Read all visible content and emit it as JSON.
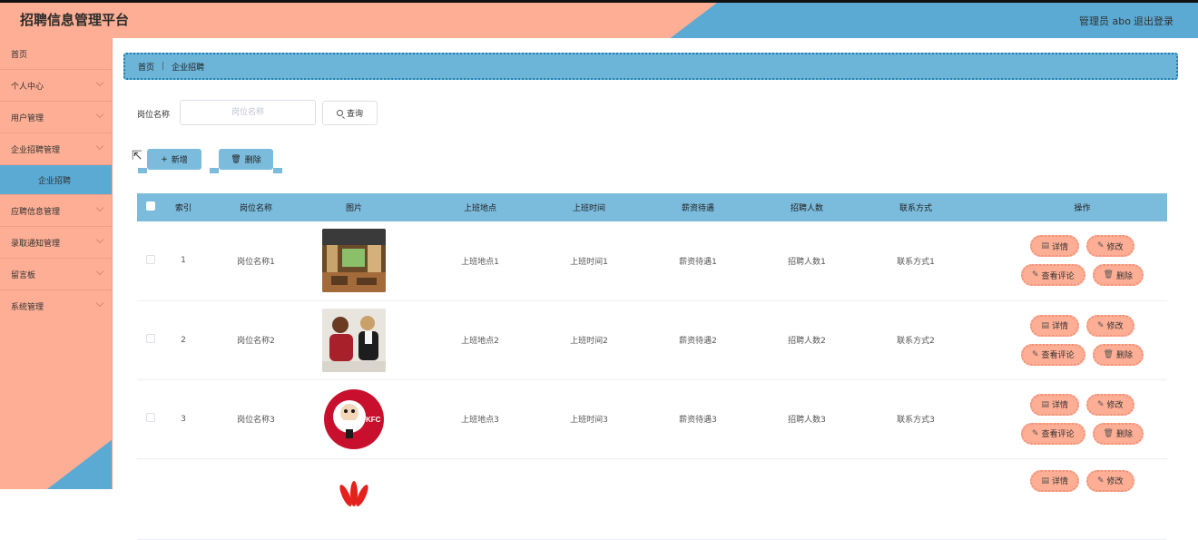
{
  "header": {
    "title": "招聘信息管理平台",
    "user": "管理员 abo",
    "logout": "退出登录"
  },
  "sidebar": {
    "items": [
      {
        "label": "首页"
      },
      {
        "label": "个人中心"
      },
      {
        "label": "用户管理"
      },
      {
        "label": "企业招聘管理"
      },
      {
        "label": "企业招聘"
      },
      {
        "label": "应聘信息管理"
      },
      {
        "label": "录取通知管理"
      },
      {
        "label": "留言板"
      },
      {
        "label": "系统管理"
      }
    ]
  },
  "breadcrumb": {
    "home": "首页",
    "sep": "|",
    "current": "企业招聘"
  },
  "search": {
    "label": "岗位名称",
    "placeholder": "岗位名称",
    "button": "查询"
  },
  "toolbar": {
    "add": "新增",
    "delete": "删除"
  },
  "table": {
    "headers": [
      "索引",
      "岗位名称",
      "图片",
      "上班地点",
      "上班时间",
      "薪资待遇",
      "招聘人数",
      "联系方式",
      "操作"
    ],
    "rows": [
      {
        "index": "1",
        "name": "岗位名称1",
        "place": "上班地点1",
        "time": "上班时间1",
        "salary": "薪资待遇1",
        "count": "招聘人数1",
        "contact": "联系方式1"
      },
      {
        "index": "2",
        "name": "岗位名称2",
        "place": "上班地点2",
        "time": "上班时间2",
        "salary": "薪资待遇2",
        "count": "招聘人数2",
        "contact": "联系方式2"
      },
      {
        "index": "3",
        "name": "岗位名称3",
        "place": "上班地点3",
        "time": "上班时间3",
        "salary": "薪资待遇3",
        "count": "招聘人数3",
        "contact": "联系方式3"
      },
      {
        "index": "",
        "name": "",
        "place": "",
        "time": "",
        "salary": "",
        "count": "",
        "contact": ""
      }
    ],
    "ops": {
      "detail": "详情",
      "edit": "修改",
      "comments": "查看评论",
      "delete": "删除"
    }
  },
  "colors": {
    "salmon": "#fdae94",
    "blue": "#5aaad4",
    "header_blue": "#7bbbdc"
  }
}
